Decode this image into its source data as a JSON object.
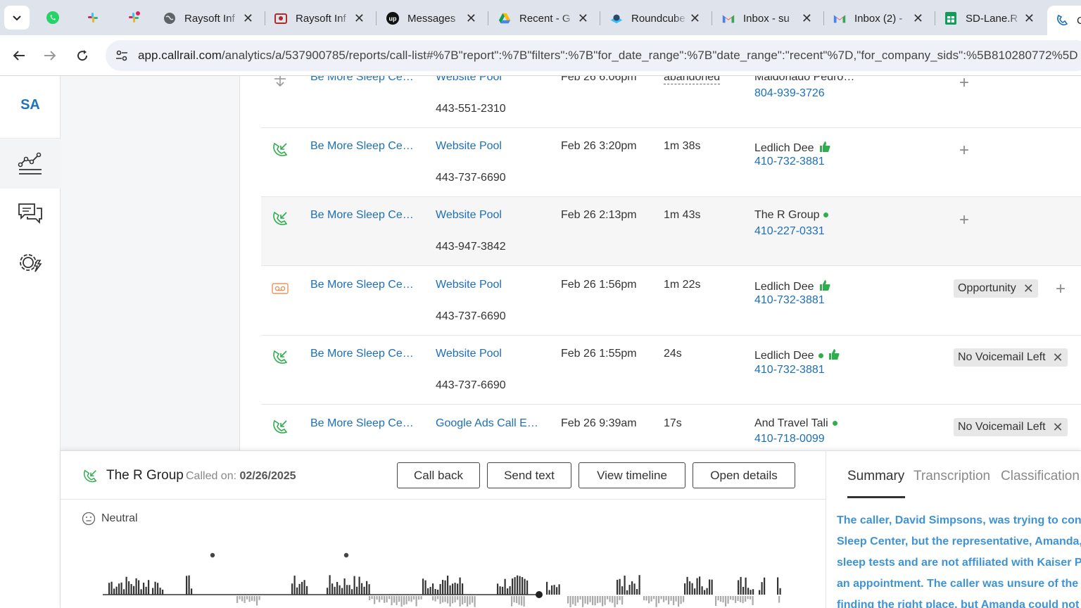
{
  "browser": {
    "tabs": [
      {
        "title": "Raysoft Inf"
      },
      {
        "title": "Raysoft Inf"
      },
      {
        "title": "Messages"
      },
      {
        "title": "Recent - G"
      },
      {
        "title": "Roundcube"
      },
      {
        "title": "Inbox - su"
      },
      {
        "title": "Inbox (2) -"
      },
      {
        "title": "SD-Lane.R"
      },
      {
        "title": "C"
      }
    ],
    "url_host": "app.callrail.com",
    "url_path": "/analytics/a/537900785/reports/call-list#%7B\"report\":%7B\"filters\":%7B\"for_date_range\":%7B\"date_range\":\"recent\"%7D,\"for_company_sids\":%5B810280772%5D"
  },
  "rail": {
    "initials": "SA"
  },
  "colors": {
    "accent": "#1d6fb8",
    "green": "#2fae4d",
    "summary": "#3f93d3"
  },
  "calls": [
    {
      "direction_icon": "voicemail-down-icon",
      "company": "Be More Sleep Ce…",
      "source": "Website Pool",
      "tracking_number": "443-551-2310",
      "datetime": "Feb 26 6:06pm",
      "duration": "abandoned",
      "caller": "Maldonado Pedro…",
      "caller_number": "804-939-3726",
      "tags": []
    },
    {
      "direction_icon": "incoming-call-icon",
      "company": "Be More Sleep Ce…",
      "source": "Website Pool",
      "tracking_number": "443-737-6690",
      "datetime": "Feb 26 3:20pm",
      "duration": "1m 38s",
      "caller": "Ledlich Dee",
      "caller_number": "410-732-3881",
      "tags": []
    },
    {
      "direction_icon": "incoming-call-icon",
      "company": "Be More Sleep Ce…",
      "source": "Website Pool",
      "tracking_number": "443-947-3842",
      "datetime": "Feb 26 2:13pm",
      "duration": "1m 43s",
      "caller": "The R Group",
      "caller_number": "410-227-0331",
      "tags": []
    },
    {
      "direction_icon": "voicemail-icon",
      "company": "Be More Sleep Ce…",
      "source": "Website Pool",
      "tracking_number": "443-737-6690",
      "datetime": "Feb 26 1:56pm",
      "duration": "1m 22s",
      "caller": "Ledlich Dee",
      "caller_number": "410-732-3881",
      "tags": [
        "Opportunity"
      ]
    },
    {
      "direction_icon": "incoming-call-icon",
      "company": "Be More Sleep Ce…",
      "source": "Website Pool",
      "tracking_number": "443-737-6690",
      "datetime": "Feb 26 1:55pm",
      "duration": "24s",
      "caller": "Ledlich Dee",
      "caller_number": "410-732-3881",
      "tags": [
        "No Voicemail Left"
      ]
    },
    {
      "direction_icon": "incoming-call-icon",
      "company": "Be More Sleep Ce…",
      "source": "Google Ads Call E…",
      "tracking_number": "",
      "datetime": "Feb 26 9:39am",
      "duration": "17s",
      "caller": "And Travel Tali",
      "caller_number": "410-718-0099",
      "tags": [
        "No Voicemail Left"
      ]
    }
  ],
  "detail": {
    "name": "The R Group",
    "called_label": "Called on:",
    "called_date": "02/26/2025",
    "buttons": {
      "call_back": "Call back",
      "send_text": "Send text",
      "view_timeline": "View timeline",
      "open_details": "Open details"
    },
    "sentiment": "Neutral",
    "tabs": {
      "summary": "Summary",
      "transcription": "Transcription",
      "classification": "Classification"
    },
    "summary_lines": [
      "The caller, David Simpsons, was trying to confi",
      "Sleep Center, but the representative, Amanda,",
      "sleep tests and are not affiliated with Kaiser Pe",
      "an appointment. The caller was unsure of the c",
      "finding the right place, but Amanda could not a"
    ]
  }
}
